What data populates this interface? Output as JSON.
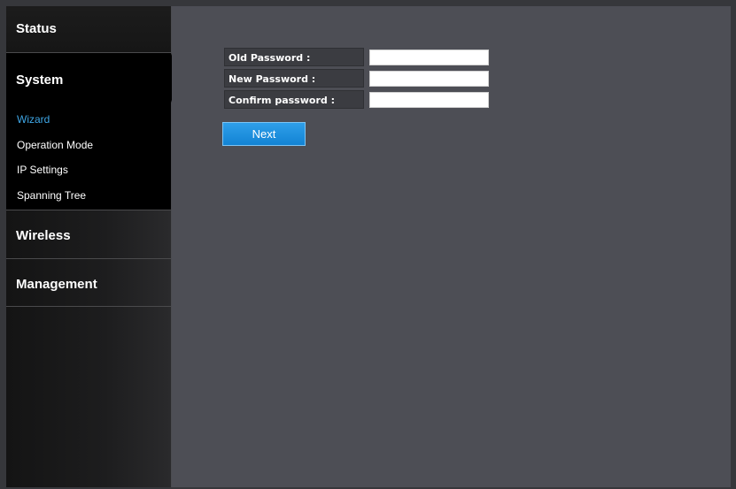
{
  "sidebar": {
    "status": "Status",
    "system": "System",
    "system_items": [
      "Wizard",
      "Operation Mode",
      "IP Settings",
      "Spanning Tree"
    ],
    "wireless": "Wireless",
    "management": "Management"
  },
  "form": {
    "old_password_label": "Old Password :",
    "new_password_label": "New Password :",
    "confirm_password_label": "Confirm password :",
    "old_password_value": "",
    "new_password_value": "",
    "confirm_password_value": "",
    "next_label": "Next"
  },
  "colors": {
    "accent": "#1a8de0",
    "active_link": "#3fa7e6",
    "content_bg": "#4d4e55"
  }
}
